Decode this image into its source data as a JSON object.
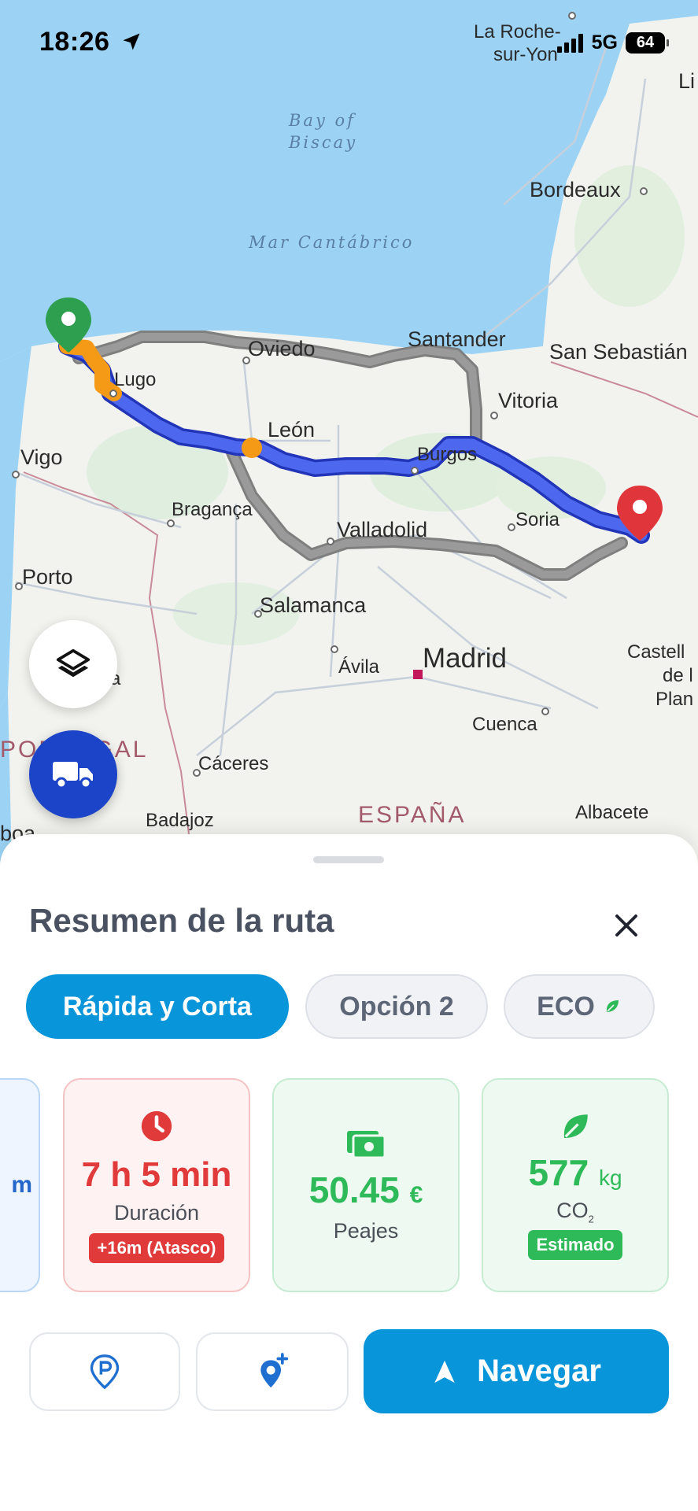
{
  "status_bar": {
    "time": "18:26",
    "network": "5G",
    "battery": "64"
  },
  "map": {
    "sea_labels": {
      "bay_line1": "Bay of",
      "bay_line2": "Biscay",
      "mar": "Mar Cantábrico"
    },
    "cities": {
      "la_roche_1": "La Roche-",
      "la_roche_2": "sur-Yon",
      "li": "Li",
      "bordeaux": "Bordeaux",
      "oviedo": "Oviedo",
      "santander": "Santander",
      "san_sebastian": "San Sebastián",
      "lugo": "Lugo",
      "vitoria": "Vitoria",
      "leon": "León",
      "vigo": "Vigo",
      "burgos": "Burgos",
      "braganca": "Bragança",
      "soria": "Soria",
      "valladolid": "Valladolid",
      "porto": "Porto",
      "salamanca": "Salamanca",
      "castell_1": "Castell",
      "castell_2": "de l",
      "castell_3": "Plan",
      "avila": "Ávila",
      "madrid": "Madrid",
      "a_partial": "a",
      "cuenca": "Cuenca",
      "caceres": "Cáceres",
      "badajoz": "Badajoz",
      "albacete": "Albacete",
      "boa": "boa"
    },
    "countries": {
      "portugal": "PORTUGAL",
      "espana": "ESPAÑA"
    },
    "colors": {
      "route_main": "#3d55e6",
      "route_alt": "#8f8f8f",
      "traffic": "#f59a17",
      "start_pin": "#2e9e4f",
      "end_pin": "#e0363b"
    }
  },
  "fabs": {
    "layers_icon": "layers-icon",
    "truck_icon": "truck-icon"
  },
  "sheet": {
    "title": "Resumen de la ruta",
    "tabs": [
      {
        "label": "Rápida y Corta",
        "active": true
      },
      {
        "label": "Opción 2",
        "active": false
      },
      {
        "label": "ECO",
        "active": false
      }
    ],
    "partial_card_text": "m",
    "duration": {
      "value": "7 h 5 min",
      "label": "Duración",
      "traffic": "+16m (Atasco)"
    },
    "tolls": {
      "value": "50.45",
      "unit": "€",
      "label": "Peajes"
    },
    "co2": {
      "value": "577",
      "unit": "kg",
      "label": "CO",
      "label_sub": "2",
      "badge": "Estimado"
    },
    "navigate_label": "Navegar",
    "colors": {
      "accent": "#0995da",
      "red": "#e03a3a",
      "green": "#2fba5a"
    }
  }
}
